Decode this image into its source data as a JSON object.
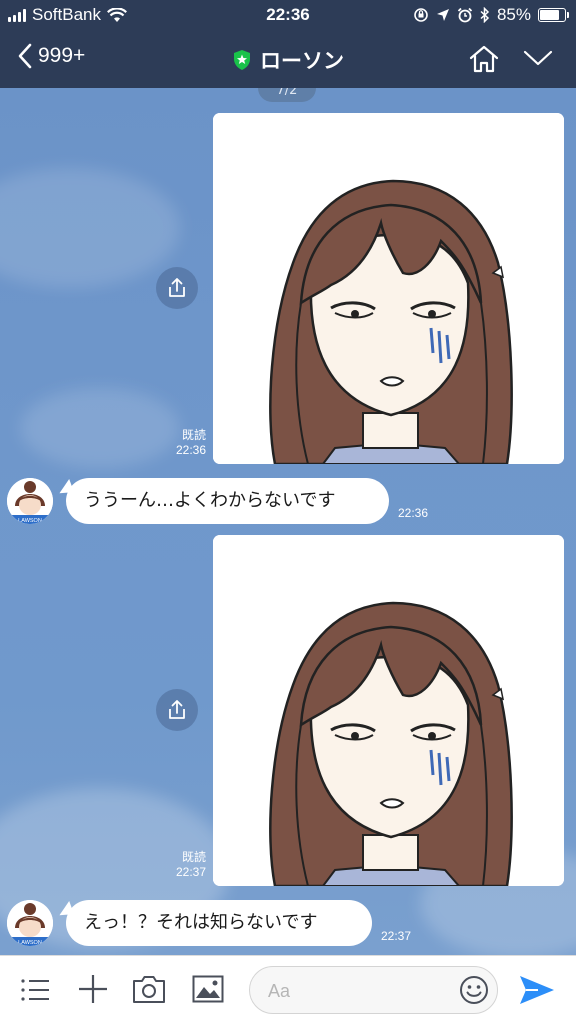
{
  "status_bar": {
    "carrier": "SoftBank",
    "time": "22:36",
    "battery": "85%",
    "battery_level": 0.85,
    "icons": [
      "signal-icon",
      "wifi-icon",
      "orientation-lock-icon",
      "location-icon",
      "alarm-icon",
      "bluetooth-icon",
      "battery-icon"
    ]
  },
  "header": {
    "back_label": "999+",
    "title": "ローソン",
    "verified_icon": "shield-star-icon",
    "home_icon": "home-icon",
    "menu_icon": "chevron-down-icon"
  },
  "chat": {
    "date_pill": "7/2",
    "messages": [
      {
        "type": "image",
        "from": "me",
        "read_label": "既読",
        "time": "22:36",
        "image_icon": "drawing-girl-worried"
      },
      {
        "type": "text",
        "from": "lawson",
        "text": "ううーん…よくわからないです",
        "time": "22:36",
        "avatar_label": "LAWSON"
      },
      {
        "type": "image",
        "from": "me",
        "read_label": "既読",
        "time": "22:37",
        "image_icon": "drawing-girl-worried"
      },
      {
        "type": "text",
        "from": "lawson",
        "text": "えっ！？それは知らないです",
        "time": "22:37",
        "avatar_label": "LAWSON"
      }
    ]
  },
  "input_bar": {
    "placeholder": "Aa",
    "icons": [
      "menu-icon",
      "plus-icon",
      "camera-icon",
      "image-icon",
      "emoji-icon",
      "send-icon"
    ]
  },
  "colors": {
    "header_bg": "#2d3c57",
    "chat_bg": "#6f97cb",
    "send_blue": "#2c8ef8",
    "bubble_bg": "#ffffff"
  }
}
